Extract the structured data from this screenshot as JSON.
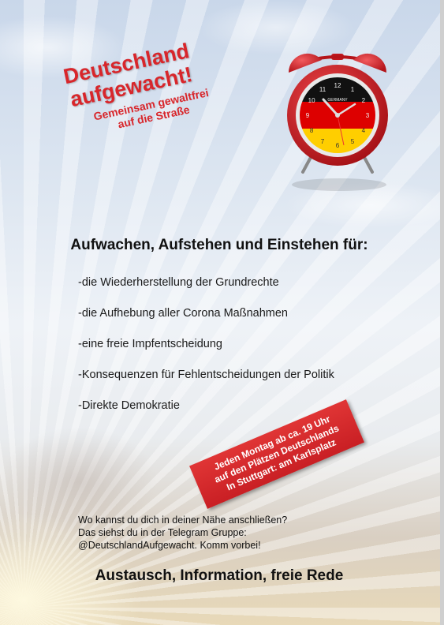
{
  "slogan": {
    "title_line1": "Deutschland",
    "title_line2": "aufgewacht!",
    "sub_line1": "Gemeinsam gewaltfrei",
    "sub_line2": "auf die Straße"
  },
  "clock": {
    "label": "GERMANY",
    "numbers": [
      "12",
      "1",
      "2",
      "3",
      "4",
      "5",
      "6",
      "7",
      "8",
      "9",
      "10",
      "11"
    ],
    "colors": {
      "body": "#d0181e",
      "black": "#111111",
      "red": "#dd0000",
      "gold": "#ffce00"
    }
  },
  "headline": "Aufwachen, Aufstehen und Einstehen für:",
  "demands": [
    "-die Wiederherstellung der Grundrechte",
    "-die Aufhebung aller Corona Maßnahmen",
    "-eine freie Impfentscheidung",
    "-Konsequenzen für Fehlentscheidungen der Politik",
    "-Direkte Demokratie"
  ],
  "badge": {
    "line1": "Jeden Montag ab ca. 19 Uhr",
    "line2": "auf den Plätzen Deutschlands",
    "line3": "In Stuttgart: am Karlsplatz"
  },
  "info": {
    "line1": "Wo kannst du dich in  deiner Nähe anschließen?",
    "line2": "Das siehst du in der Telegram Gruppe:",
    "line3": "@DeutschlandAufgewacht. Komm vorbei!"
  },
  "footer": "Austausch, Information, freie Rede",
  "colors": {
    "accent_red": "#d8262b",
    "text": "#111111"
  }
}
